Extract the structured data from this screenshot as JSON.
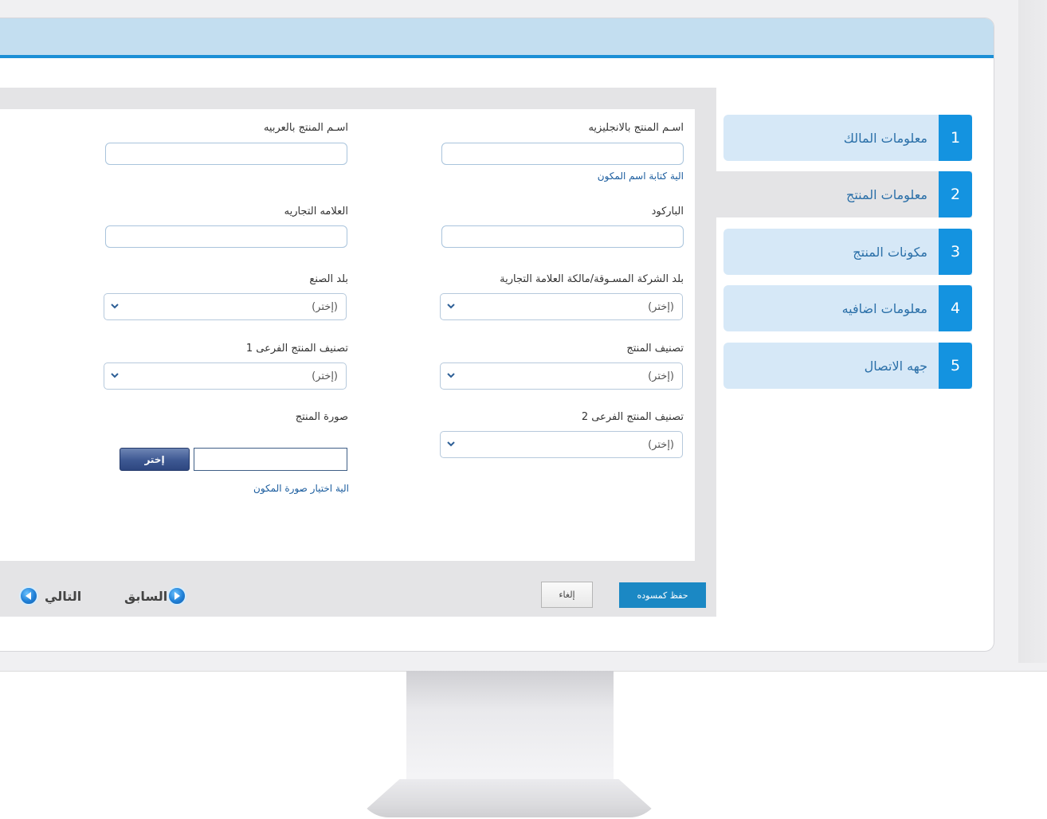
{
  "steps": [
    {
      "num": "1",
      "label": "معلومات المالك"
    },
    {
      "num": "2",
      "label": "معلومات المنتج"
    },
    {
      "num": "3",
      "label": "مكونات المنتج"
    },
    {
      "num": "4",
      "label": "معلومات اضافيه"
    },
    {
      "num": "5",
      "label": "جهه الاتصال"
    }
  ],
  "form": {
    "name_en_label": "اسـم المنتج بالانجليزيه",
    "name_ar_label": "اسـم المنتج بالعربيه",
    "name_help": "الية كتابة اسم المكون",
    "barcode_label": "الباركود",
    "brand_label": "العلامه التجاريه",
    "marketing_country_label": "بلد الشركة المسـوقة/مالكة العلامة التجارية",
    "manufacture_country_label": "بلد الصنع",
    "category_label": "تصنيف المنتج",
    "subcategory1_label": "تصنيف المنتج الفرعى 1",
    "subcategory2_label": "تصنيف المنتج الفرعى 2",
    "image_label": "صورة المنتج",
    "select_placeholder": "(إختر)",
    "choose_button": "إختر",
    "image_help": "الية اختيار صورة المكون"
  },
  "actions": {
    "save_draft": "حفظ كمسوده",
    "cancel": "إلغاء",
    "previous": "السابق",
    "next": "التالي"
  }
}
